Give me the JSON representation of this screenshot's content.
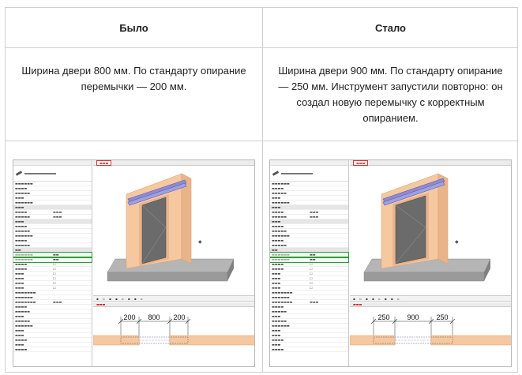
{
  "table": {
    "col_before_title": "Было",
    "col_after_title": "Стало",
    "before_text": "Ширина двери 800 мм. По стандарту опирание перемычки — 200 мм.",
    "after_text": "Ширина двери 900 мм. По стандарту опирание — 250 мм. Инструмент запустили повторно: он создал новую перемычку с корректным опиранием."
  },
  "before_shot": {
    "dims": {
      "left": "200",
      "middle": "800",
      "right": "200"
    }
  },
  "after_shot": {
    "dims": {
      "left": "250",
      "middle": "900",
      "right": "250"
    }
  },
  "colors": {
    "wall": "#f6c8a0",
    "wall_edge": "#d9a478",
    "door": "#6b6b6b",
    "base": "#9a9a9a",
    "lintel": "#8c8cd6",
    "highlight": "#2e9a3b",
    "tab_accent": "#cc0000"
  }
}
